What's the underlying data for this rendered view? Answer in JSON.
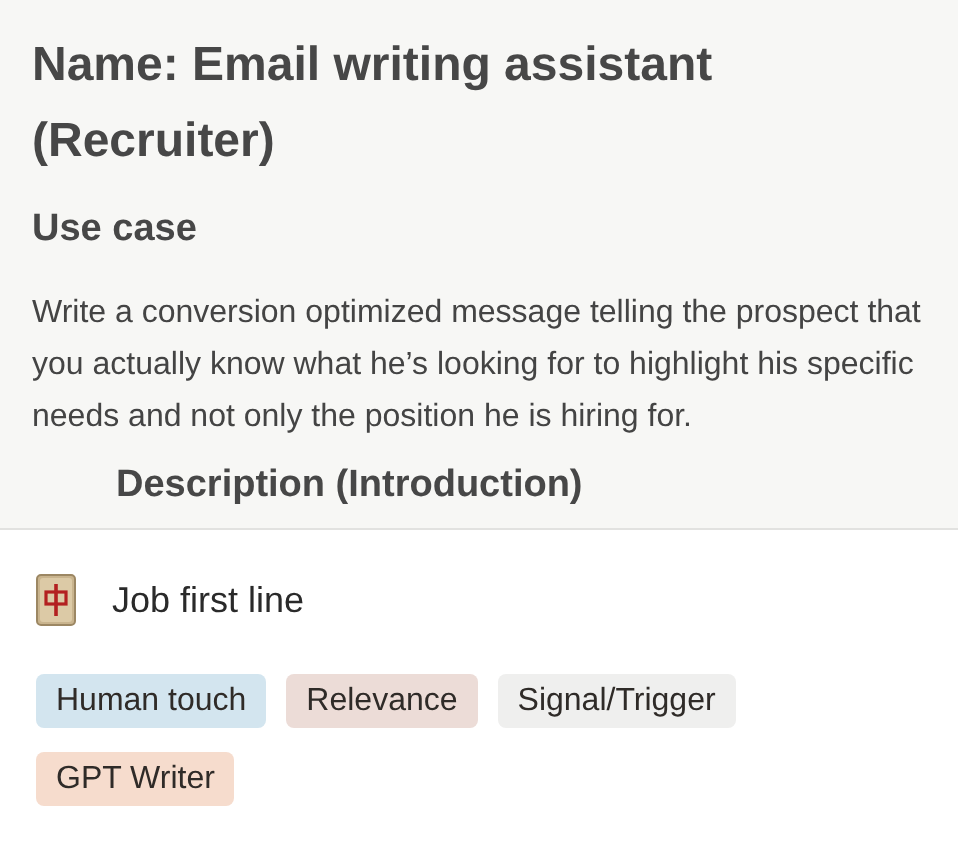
{
  "document": {
    "title": "Name: Email writing assistant (Recruiter)",
    "section_heading": "Use case",
    "body": "Write a conversion optimized message telling the prospect that you actually know what he’s looking for to highlight his specific needs and not only the position he is hiring for.",
    "next_heading": "Description (Introduction)"
  },
  "card": {
    "title": "Job first line",
    "tags": [
      {
        "label": "Human touch",
        "color": "#d3e5ef"
      },
      {
        "label": "Relevance",
        "color": "#ecdcd7"
      },
      {
        "label": "Signal/Trigger",
        "color": "#efefee"
      },
      {
        "label": "GPT Writer",
        "color": "#f6dccd"
      }
    ]
  }
}
